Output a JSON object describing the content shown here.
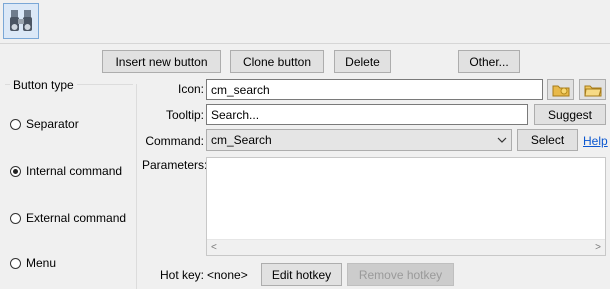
{
  "toolbar": {
    "button_icon": "binoculars-icon"
  },
  "actions": {
    "insert_new_button": "Insert new button",
    "clone_button": "Clone button",
    "delete": "Delete",
    "other": "Other..."
  },
  "button_type": {
    "title": "Button type",
    "options": [
      {
        "label": "Separator",
        "checked": false
      },
      {
        "label": "Internal command",
        "checked": true
      },
      {
        "label": "External command",
        "checked": false
      },
      {
        "label": "Menu",
        "checked": false
      }
    ]
  },
  "fields": {
    "icon_label": "Icon:",
    "icon_value": "cm_search",
    "tooltip_label": "Tooltip:",
    "tooltip_value": "Search...",
    "suggest_label": "Suggest",
    "command_label": "Command:",
    "command_value": "cm_Search",
    "select_label": "Select",
    "help_label": "Help",
    "parameters_label": "Parameters:",
    "hotkey_label": "Hot key:",
    "hotkey_value": "<none>",
    "edit_hotkey": "Edit hotkey",
    "remove_hotkey": "Remove hotkey"
  },
  "colors": {
    "accent": "#0b57d0",
    "disabled": "#cccccc"
  }
}
